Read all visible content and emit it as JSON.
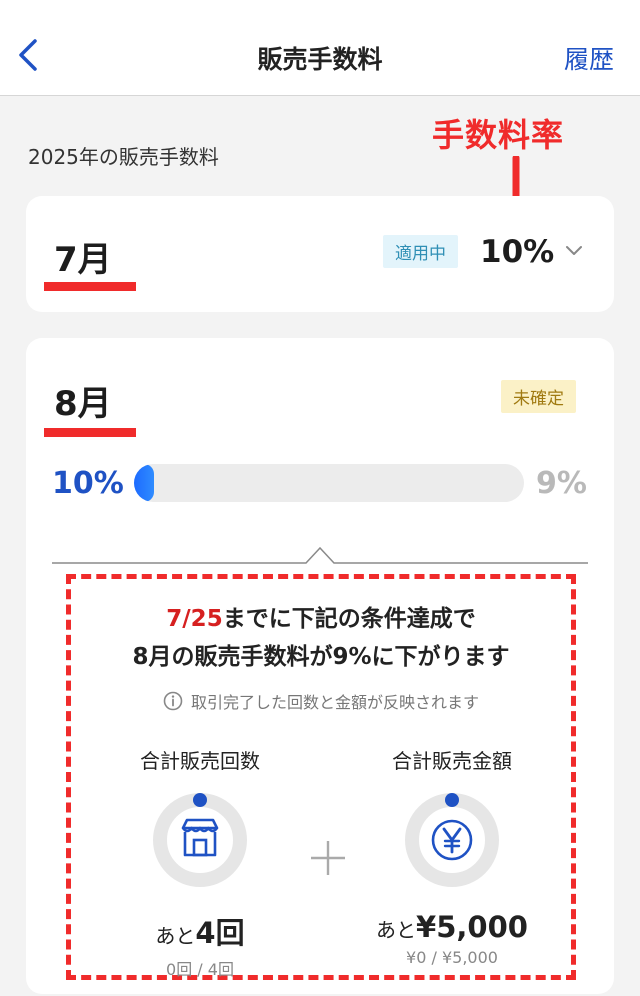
{
  "header": {
    "title": "販売手数料",
    "history_label": "履歴"
  },
  "year_label": "2025年の販売手数料",
  "annotation": {
    "rate_label": "手数料率"
  },
  "july": {
    "month": "7月",
    "status_badge": "適用中",
    "rate": "10%"
  },
  "august": {
    "month": "8月",
    "status_badge": "未確定",
    "rate_current": "10%",
    "rate_target": "9%",
    "progress_fraction": 0.04,
    "condition": {
      "deadline": "7/25",
      "line1_rest": "までに下記の条件達成で",
      "line2": "8月の販売手数料が9%に下がります",
      "note": "取引完了した回数と金額が反映されます"
    },
    "count": {
      "title": "合計販売回数",
      "remaining_prefix": "あと",
      "remaining_value": "4回",
      "progress_text": "0回 / 4回",
      "progress_fraction": 0
    },
    "amount": {
      "title": "合計販売金額",
      "remaining_prefix": "あと",
      "remaining_value": "¥5,000",
      "progress_text": "¥0 / ¥5,000",
      "progress_fraction": 0
    }
  },
  "colors": {
    "accent_blue": "#1f52c4",
    "annotation_red": "#f02b2b"
  },
  "icons": {
    "back": "chevron-left-icon",
    "dropdown": "chevron-down-icon",
    "info": "info-icon",
    "store": "store-icon",
    "yen": "yen-coin-icon",
    "plus": "plus-icon"
  }
}
